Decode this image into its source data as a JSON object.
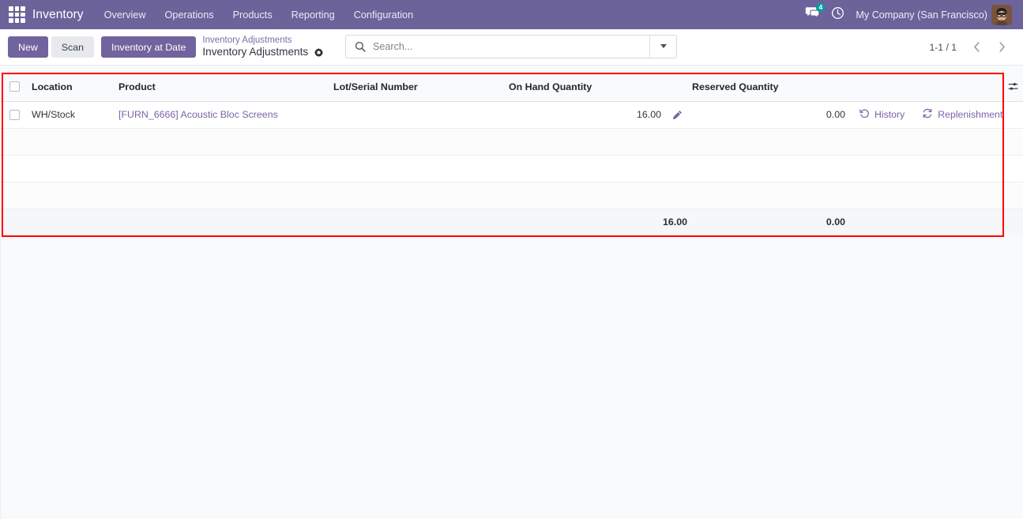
{
  "navbar": {
    "apps_icon": "apps-grid-icon",
    "brand": "Inventory",
    "menu": [
      {
        "label": "Overview"
      },
      {
        "label": "Operations"
      },
      {
        "label": "Products"
      },
      {
        "label": "Reporting"
      },
      {
        "label": "Configuration"
      }
    ],
    "messages_icon": "chat-bubbles-icon",
    "messages_count": "4",
    "activities_icon": "clock-icon",
    "company": "My Company (San Francisco)",
    "avatar_icon": "user-avatar",
    "background_color": "#6C639B",
    "badge_color": "#00A09D"
  },
  "control_panel": {
    "new_label": "New",
    "scan_label": "Scan",
    "inventory_at_date_label": "Inventory at Date",
    "breadcrumb_parent": "Inventory Adjustments",
    "breadcrumb_current": "Inventory Adjustments",
    "cog_icon": "gear-icon",
    "search": {
      "icon": "search-icon",
      "placeholder": "Search...",
      "value": "",
      "toggle_icon": "chevron-down-icon"
    },
    "pager": {
      "value": "1-1 / 1",
      "previous_icon": "chevron-left-icon",
      "next_icon": "chevron-right-icon"
    },
    "accent_color": "#71639E"
  },
  "list": {
    "highlight_color": "#FF0000",
    "optional_columns_icon": "sliders-icon",
    "columns": [
      {
        "label": "Location"
      },
      {
        "label": "Product"
      },
      {
        "label": "Lot/Serial Number"
      },
      {
        "label": "On Hand Quantity"
      },
      {
        "label": "Reserved Quantity"
      }
    ],
    "rows": [
      {
        "location": "WH/Stock",
        "product": "[FURN_6666] Acoustic Bloc Screens",
        "lot_serial": "",
        "on_hand_quantity": "16.00",
        "edit_icon": "pencil-icon",
        "reserved_quantity": "0.00",
        "history_label": "History",
        "history_icon": "history-icon",
        "replenishment_label": "Replenishment",
        "replenishment_icon": "refresh-icon"
      }
    ],
    "totals": {
      "on_hand_quantity": "16.00",
      "reserved_quantity": "0.00"
    }
  }
}
